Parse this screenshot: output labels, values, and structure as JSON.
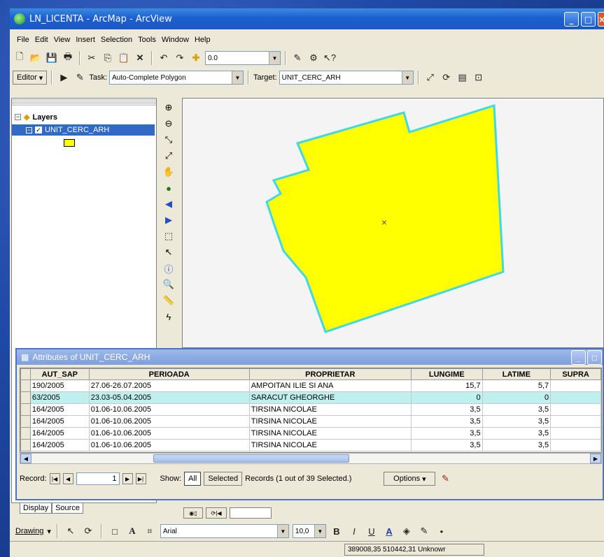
{
  "window": {
    "title": "LN_LICENTA - ArcMap - ArcView"
  },
  "menu": [
    "File",
    "Edit",
    "View",
    "Insert",
    "Selection",
    "Tools",
    "Window",
    "Help"
  ],
  "standard_toolbar": {
    "scale_value": "0.0"
  },
  "editor_toolbar": {
    "editor_label": "Editor",
    "task_label": "Task:",
    "task_value": "Auto-Complete Polygon",
    "target_label": "Target:",
    "target_value": "UNIT_CERC_ARH"
  },
  "toc": {
    "layers_label": "Layers",
    "layer_name": "UNIT_CERC_ARH",
    "symbol_color": "#ffff00",
    "tabs": [
      "Display",
      "Source"
    ]
  },
  "map": {
    "polygon_fill": "#ffff00",
    "polygon_outline": "#3fd8e6",
    "background": "#f4f4f4"
  },
  "attributes": {
    "title": "Attributes of UNIT_CERC_ARH",
    "columns": [
      "AUT_SAP",
      "PERIOADA",
      "PROPRIETAR",
      "LUNGIME",
      "LATIME",
      "SUPRA"
    ],
    "rows": [
      [
        "190/2005",
        "27.06-26.07.2005",
        "AMPOITAN ILIE SI ANA",
        "15,7",
        "5,7",
        ""
      ],
      [
        "63/2005",
        "23.03-05.04.2005",
        "SARACUT GHEORGHE",
        "0",
        "0",
        ""
      ],
      [
        "164/2005",
        "01.06-10.06.2005",
        "TIRSINA NICOLAE",
        "3,5",
        "3,5",
        ""
      ],
      [
        "164/2005",
        "01.06-10.06.2005",
        "TIRSINA NICOLAE",
        "3,5",
        "3,5",
        ""
      ],
      [
        "164/2005",
        "01.06-10.06.2005",
        "TIRSINA NICOLAE",
        "3,5",
        "3,5",
        ""
      ],
      [
        "164/2005",
        "01.06-10.06.2005",
        "TIRSINA NICOLAE",
        "3,5",
        "3,5",
        ""
      ]
    ],
    "selected_row": 1,
    "selected_color": "#bff0f0",
    "record_label": "Record:",
    "record_value": "1",
    "show_label": "Show:",
    "all_label": "All",
    "selected_label": "Selected",
    "records_status": "Records (1 out of 39 Selected.)",
    "options_label": "Options"
  },
  "drawing_toolbar": {
    "drawing_label": "Drawing",
    "font_name": "Arial",
    "font_size": "10,0"
  },
  "status": {
    "coords": "389008,35 510442,31 Unknowr"
  }
}
